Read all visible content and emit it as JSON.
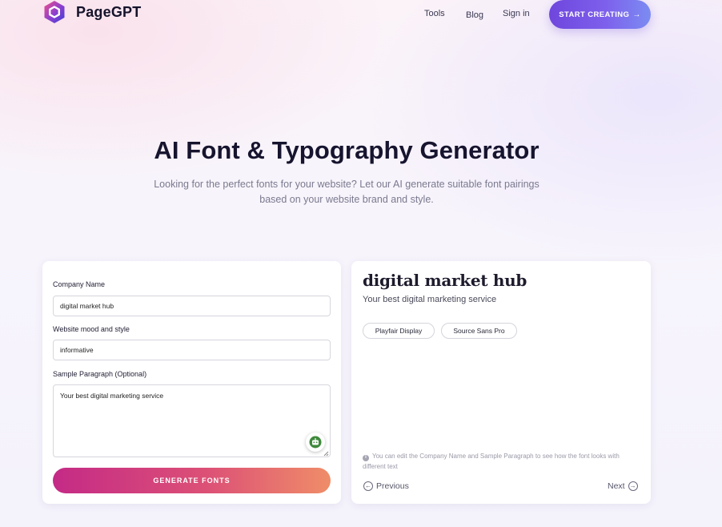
{
  "brand": {
    "name": "PageGPT"
  },
  "nav": {
    "tools": "Tools",
    "blog": "Blog",
    "signin": "Sign in",
    "cta": "START CREATING",
    "cta_arrow": "→"
  },
  "hero": {
    "title": "AI Font & Typography Generator",
    "subtitle": "Looking for the perfect fonts for your website? Let our AI generate suitable font pairings based on your website brand and style."
  },
  "form": {
    "company_label": "Company Name",
    "company_value": "digital market hub",
    "mood_label": "Website mood and style",
    "mood_value": "informative",
    "sample_label": "Sample Paragraph (Optional)",
    "sample_value": "Your best digital marketing service",
    "generate_label": "GENERATE FONTS"
  },
  "preview": {
    "title": "digital market hub",
    "subtitle": "Your best digital marketing service",
    "heading_font": "Playfair Display",
    "body_font": "Source Sans Pro",
    "note": "You can edit the Company Name and Sample Paragraph to see how the font looks with different text",
    "previous_label": "Previous",
    "next_label": "Next"
  },
  "colors": {
    "cta_gradient": [
      "#6f46dd",
      "#7c8cf2"
    ],
    "generate_gradient": [
      "#c42a86",
      "#ef8d68"
    ],
    "logo_gradient": [
      "#e0447e",
      "#4f3fd8"
    ]
  },
  "icons": {
    "logo": "hexagon-logo-icon",
    "cta_arrow": "arrow-right-icon",
    "assistant": "assistant-robot-icon",
    "info": "info-icon",
    "previous": "arrow-left-circle-icon",
    "next": "arrow-right-circle-icon"
  }
}
